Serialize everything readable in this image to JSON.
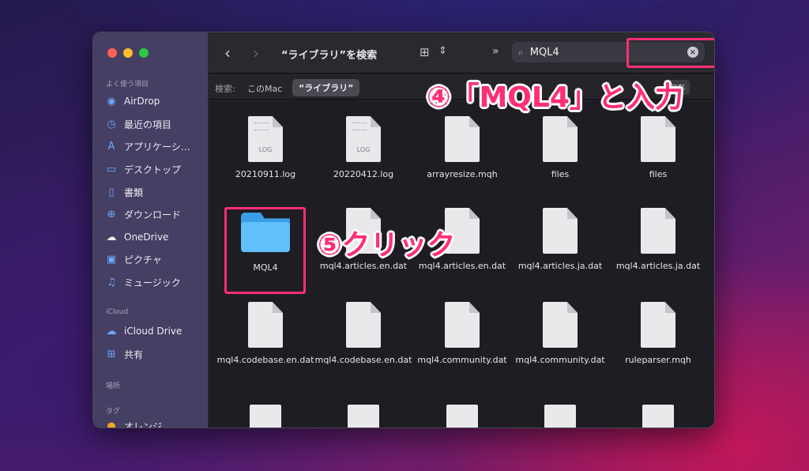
{
  "sidebar": {
    "favorites_header": "よく使う項目",
    "favorites": [
      {
        "label": "AirDrop",
        "icon": "airdrop-icon"
      },
      {
        "label": "最近の項目",
        "icon": "clock-icon"
      },
      {
        "label": "アプリケーシ…",
        "icon": "applications-icon"
      },
      {
        "label": "デスクトップ",
        "icon": "desktop-icon"
      },
      {
        "label": "書類",
        "icon": "document-icon"
      },
      {
        "label": "ダウンロード",
        "icon": "download-icon"
      },
      {
        "label": "OneDrive",
        "icon": "cloud-icon"
      },
      {
        "label": "ピクチャ",
        "icon": "photo-icon"
      },
      {
        "label": "ミュージック",
        "icon": "music-icon"
      }
    ],
    "icloud_header": "iCloud",
    "icloud": [
      {
        "label": "iCloud Drive",
        "icon": "icloud-icon"
      },
      {
        "label": "共有",
        "icon": "shared-folder-icon"
      }
    ],
    "locations_header": "場所",
    "tags_header": "タグ",
    "tags": [
      {
        "label": "オレンジ",
        "color": "#f5a623"
      }
    ]
  },
  "toolbar": {
    "back": "‹",
    "forward": "›",
    "title": "“ライブラリ”を検索",
    "more": "»"
  },
  "search": {
    "value": "MQL4"
  },
  "scope": {
    "label": "検索:",
    "this_mac": "このMac",
    "library": "“ライブラリ”",
    "save": "保存"
  },
  "files": [
    {
      "name": "20210911.log",
      "kind": "log",
      "tag": "LOG"
    },
    {
      "name": "20220412.log",
      "kind": "log",
      "tag": "LOG"
    },
    {
      "name": "arrayresize.mqh",
      "kind": "doc"
    },
    {
      "name": "files",
      "kind": "doc"
    },
    {
      "name": "files",
      "kind": "doc"
    },
    {
      "name": "MQL4",
      "kind": "folder"
    },
    {
      "name": "mql4.articles.en.dat",
      "kind": "doc"
    },
    {
      "name": "mql4.articles.en.dat",
      "kind": "doc"
    },
    {
      "name": "mql4.articles.ja.dat",
      "kind": "doc"
    },
    {
      "name": "mql4.articles.ja.dat",
      "kind": "doc"
    },
    {
      "name": "mql4.codebase.en.dat",
      "kind": "doc"
    },
    {
      "name": "mql4.codebase.en.dat",
      "kind": "doc"
    },
    {
      "name": "mql4.community.dat",
      "kind": "doc"
    },
    {
      "name": "mql4.community.dat",
      "kind": "doc"
    },
    {
      "name": "ruleparser.mqh",
      "kind": "doc"
    }
  ],
  "annotations": {
    "step4": "④「MQL4」と入力",
    "step5": "⑤クリック",
    "highlight_color": "#ff2f74"
  }
}
